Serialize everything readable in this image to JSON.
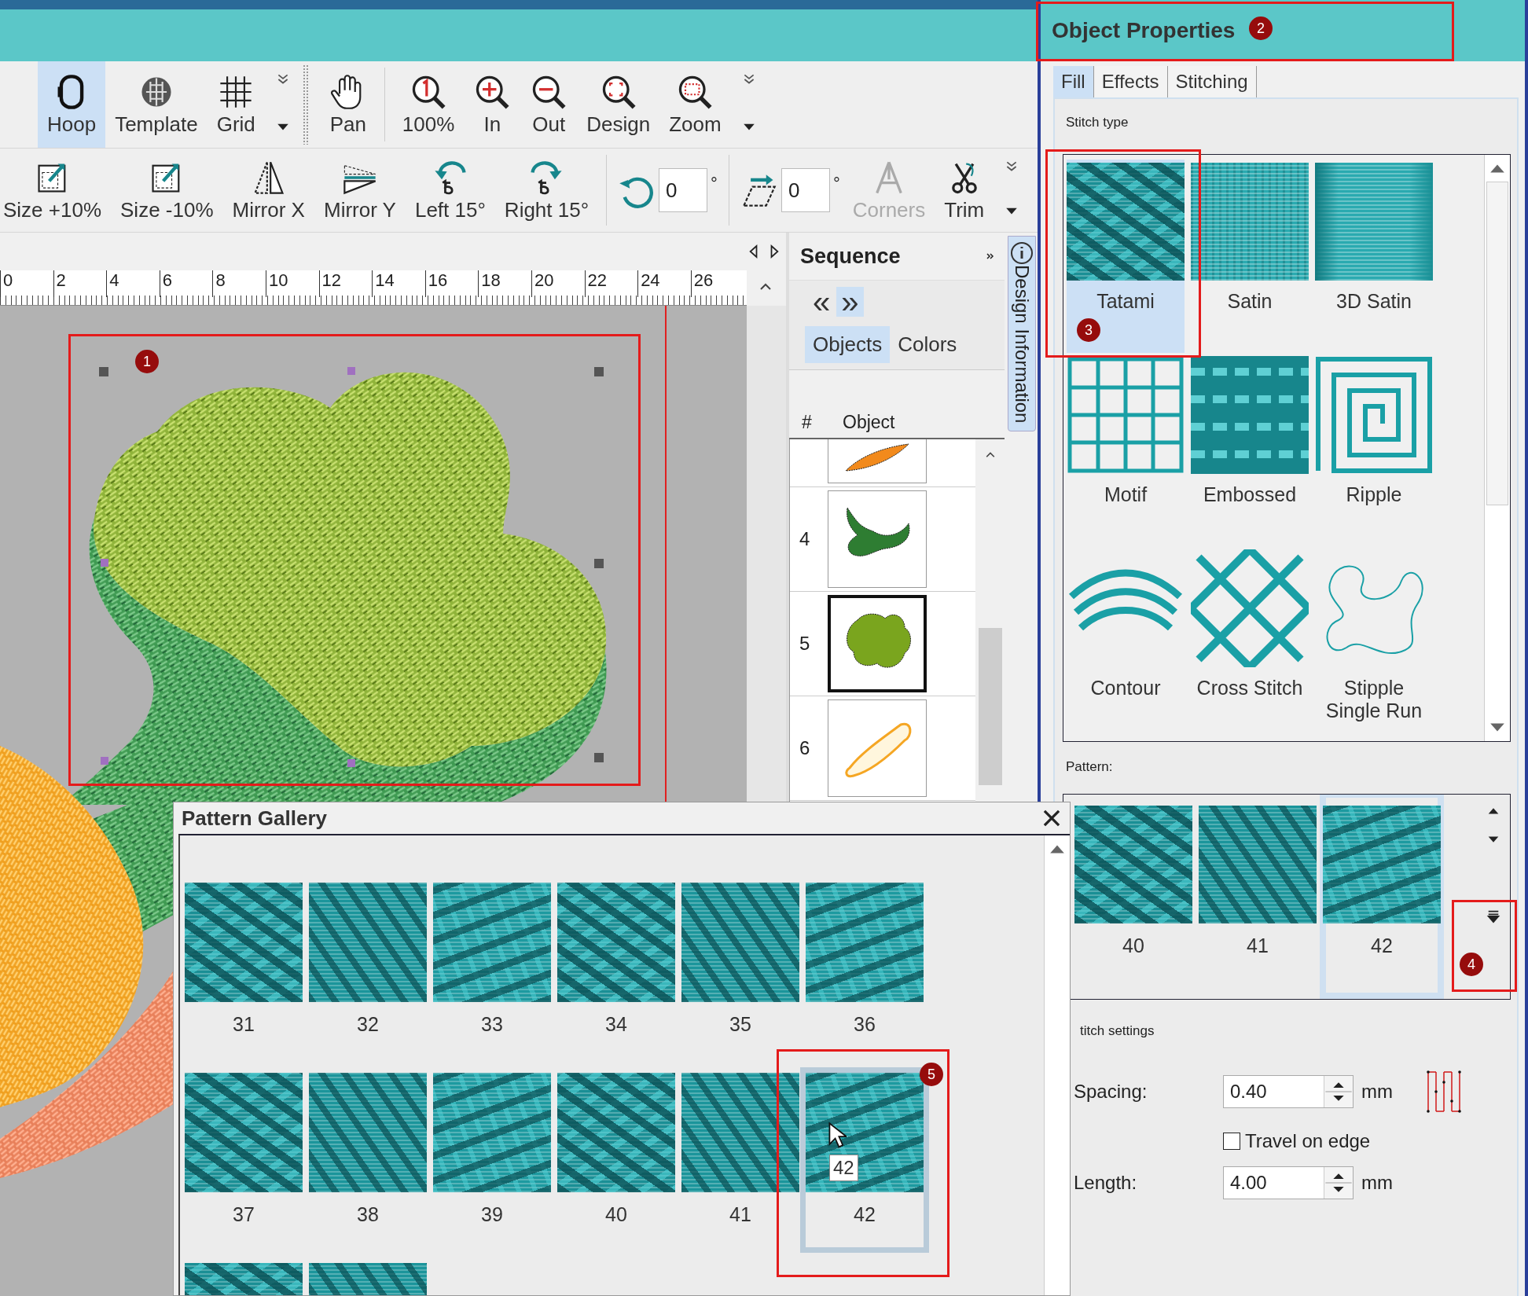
{
  "toolbar": {
    "row_1": [
      {
        "items": [
          {
            "label": "Hoop",
            "selected": true
          },
          {
            "label": "Template",
            "selected": false
          },
          {
            "label": "Grid",
            "selected": false
          }
        ]
      },
      {
        "items": [
          {
            "label": "Pan",
            "selected": false
          }
        ]
      },
      {
        "items": [
          {
            "label": "100%",
            "selected": false
          },
          {
            "label": "In",
            "selected": false
          },
          {
            "label": "Out",
            "selected": false
          },
          {
            "label": "Design",
            "selected": false
          },
          {
            "label": "Zoom",
            "selected": false
          }
        ]
      }
    ],
    "row_2": [
      {
        "items": [
          {
            "kind": "button",
            "label": "Size +10%",
            "disabled": false
          },
          {
            "kind": "button",
            "label": "Size -10%",
            "disabled": false
          },
          {
            "kind": "button",
            "label": "Mirror X",
            "disabled": false
          },
          {
            "kind": "button",
            "label": "Mirror Y",
            "disabled": false
          },
          {
            "kind": "button",
            "label": "Left 15°",
            "disabled": false
          },
          {
            "kind": "button",
            "label": "Right 15°",
            "disabled": false
          }
        ]
      },
      {
        "items": [
          {
            "kind": "field",
            "value": "0",
            "unit": "°"
          }
        ]
      },
      {
        "items": [
          {
            "kind": "field",
            "value": "0",
            "unit": "°"
          },
          {
            "kind": "button",
            "label": "Corners",
            "disabled": true
          },
          {
            "kind": "button",
            "label": "Trim",
            "disabled": false
          }
        ]
      }
    ]
  },
  "ruler": {
    "labels": [
      "0",
      "2",
      "4",
      "6",
      "8",
      "10",
      "12",
      "14",
      "16",
      "18",
      "20",
      "22",
      "24",
      "26"
    ]
  },
  "sequence": {
    "title": "Sequence",
    "nav": [
      {
        "label": "«",
        "selected": false
      },
      {
        "label": "»",
        "selected": true
      }
    ],
    "tabs": [
      {
        "label": "Objects",
        "selected": true
      },
      {
        "label": "Colors",
        "selected": false
      }
    ],
    "columns": [
      "#",
      "Object"
    ],
    "rows": [
      {
        "color": "#f28a1c",
        "selected": false
      },
      {
        "number": "4",
        "color": "#2e7d32",
        "selected": false
      },
      {
        "number": "5",
        "color": "#7aa51e",
        "selected": true
      },
      {
        "number": "6",
        "color": "#f5a623",
        "selected": false
      }
    ]
  },
  "side_tab": {
    "label": "Design Information"
  },
  "object_properties": {
    "title": "Object Properties",
    "tabs": [
      {
        "label": "Fill",
        "selected": true
      },
      {
        "label": "Effects",
        "selected": false
      },
      {
        "label": "Stitching",
        "selected": false
      }
    ],
    "stitch_type_label": "Stitch type",
    "stitch_types": [
      {
        "label": "Tatami",
        "selected": true
      },
      {
        "label": "Satin",
        "selected": false
      },
      {
        "label": "3D Satin",
        "selected": false
      },
      {
        "label": "Motif",
        "selected": false
      },
      {
        "label": "Embossed",
        "selected": false
      },
      {
        "label": "Ripple",
        "selected": false
      },
      {
        "label": "Contour",
        "selected": false
      },
      {
        "label": "Cross Stitch",
        "selected": false
      },
      {
        "label": "Stipple Single Run",
        "selected": false
      }
    ],
    "pattern_label": "Pattern:",
    "patterns": [
      {
        "label": "40",
        "selected": false
      },
      {
        "label": "41",
        "selected": false
      },
      {
        "label": "42",
        "selected": true
      }
    ],
    "settings_label": "titch settings",
    "spacing": {
      "label": "Spacing:",
      "value": "0.40",
      "unit": "mm"
    },
    "travel_on_edge": {
      "label": "Travel on edge",
      "checked": false
    },
    "length": {
      "label": "Length:",
      "value": "4.00",
      "unit": "mm"
    }
  },
  "pattern_gallery": {
    "title": "Pattern Gallery",
    "items": [
      {
        "label": "31",
        "selected": false
      },
      {
        "label": "32",
        "selected": false
      },
      {
        "label": "33",
        "selected": false
      },
      {
        "label": "34",
        "selected": false
      },
      {
        "label": "35",
        "selected": false
      },
      {
        "label": "36",
        "selected": false
      },
      {
        "label": "37",
        "selected": false
      },
      {
        "label": "38",
        "selected": false
      },
      {
        "label": "39",
        "selected": false
      },
      {
        "label": "40",
        "selected": false
      },
      {
        "label": "41",
        "selected": false
      },
      {
        "label": "42",
        "selected": true
      }
    ],
    "tooltip": "42"
  },
  "callouts": [
    {
      "number": "1"
    },
    {
      "number": "2"
    },
    {
      "number": "3"
    },
    {
      "number": "4"
    },
    {
      "number": "5"
    }
  ]
}
